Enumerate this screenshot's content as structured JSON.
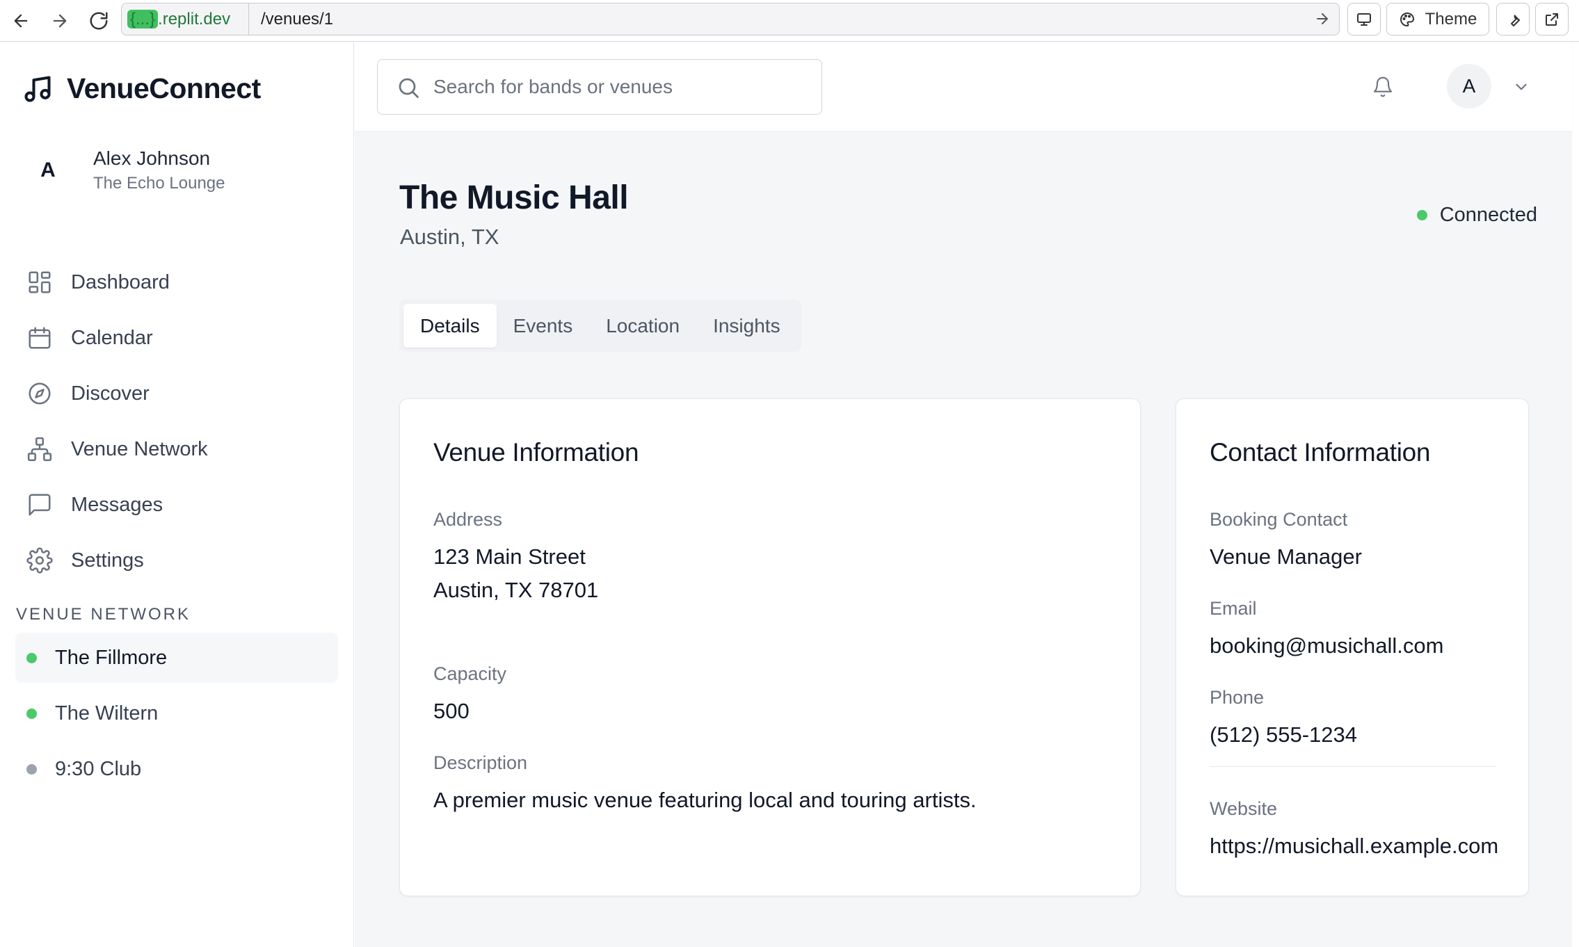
{
  "browser": {
    "url_host_highlight": "{...}",
    "url_host": ".replit.dev",
    "url_path": "/venues/1",
    "theme_label": "Theme"
  },
  "sidebar": {
    "brand": "VenueConnect",
    "user": {
      "initial": "A",
      "name": "Alex Johnson",
      "venue": "The Echo Lounge"
    },
    "nav": [
      {
        "label": "Dashboard",
        "icon": "dashboard-icon"
      },
      {
        "label": "Calendar",
        "icon": "calendar-icon"
      },
      {
        "label": "Discover",
        "icon": "compass-icon"
      },
      {
        "label": "Venue Network",
        "icon": "network-icon"
      },
      {
        "label": "Messages",
        "icon": "message-icon"
      },
      {
        "label": "Settings",
        "icon": "gear-icon"
      }
    ],
    "network_title": "VENUE NETWORK",
    "network": [
      {
        "label": "The Fillmore",
        "status": "connected",
        "color": "#4cc96a"
      },
      {
        "label": "The Wiltern",
        "status": "connected",
        "color": "#4cc96a"
      },
      {
        "label": "9:30 Club",
        "status": "pending",
        "color": "#9ca3af"
      }
    ]
  },
  "topbar": {
    "search_placeholder": "Search for bands or venues",
    "avatar_initial": "A"
  },
  "venue": {
    "name": "The Music Hall",
    "location": "Austin, TX",
    "status": "Connected",
    "status_color": "#4cc96a",
    "tabs": [
      {
        "label": "Details",
        "active": true
      },
      {
        "label": "Events",
        "active": false
      },
      {
        "label": "Location",
        "active": false
      },
      {
        "label": "Insights",
        "active": false
      }
    ],
    "info": {
      "title": "Venue Information",
      "address_label": "Address",
      "address_line1": "123 Main Street",
      "address_line2": "Austin, TX 78701",
      "capacity_label": "Capacity",
      "capacity": "500",
      "description_label": "Description",
      "description": "A premier music venue featuring local and touring artists."
    },
    "contact": {
      "title": "Contact Information",
      "booking_label": "Booking Contact",
      "booking": "Venue Manager",
      "email_label": "Email",
      "email": "booking@musichall.com",
      "phone_label": "Phone",
      "phone": "(512) 555-1234",
      "website_label": "Website",
      "website": "https://musichall.example.com"
    }
  }
}
